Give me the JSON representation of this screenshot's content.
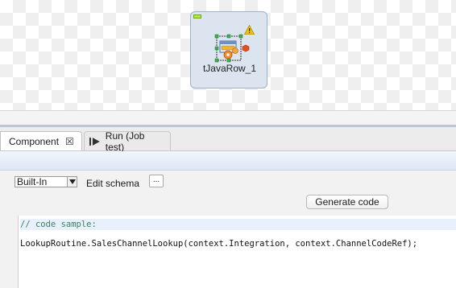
{
  "designer": {
    "component_label": "tJavaRow_1"
  },
  "tabs": [
    {
      "label": "Component",
      "close_glyph": "☒",
      "active": true
    },
    {
      "label": "Run (Job test)",
      "active": false
    }
  ],
  "settings": {
    "schema_mode": "Built-In",
    "edit_schema_label": "Edit schema",
    "ellipsis_label": "...",
    "generate_code_label": "Generate code"
  },
  "editor": {
    "comment": "// code sample:",
    "code": "LookupRoutine.SalesChannelLookup(context.Integration, context.ChannelCodeRef);"
  },
  "colors": {
    "warning": "#f5c400",
    "status_ok": "#b5e84a",
    "comment_text": "#3f7f5f"
  },
  "icons": {
    "node": "java-row-component-icon",
    "warning": "warning-icon",
    "run": "run-icon",
    "close": "close-icon",
    "dropdown": "chevron-down-icon"
  }
}
